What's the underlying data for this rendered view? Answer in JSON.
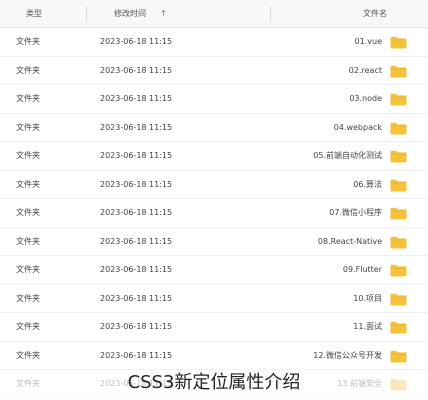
{
  "header": {
    "type_label": "类型",
    "time_label": "修改时间",
    "sort_arrow": "↑",
    "name_label": "文件名"
  },
  "rows": [
    {
      "type": "文件夹",
      "time": "2023-06-18 11:15",
      "name": "01.vue"
    },
    {
      "type": "文件夹",
      "time": "2023-06-18 11:15",
      "name": "02.react"
    },
    {
      "type": "文件夹",
      "time": "2023-06-18 11:15",
      "name": "03.node"
    },
    {
      "type": "文件夹",
      "time": "2023-06-18 11:15",
      "name": "04.webpack"
    },
    {
      "type": "文件夹",
      "time": "2023-06-18 11:15",
      "name": "05.前端自动化测试"
    },
    {
      "type": "文件夹",
      "time": "2023-06-18 11:15",
      "name": "06.算法"
    },
    {
      "type": "文件夹",
      "time": "2023-06-18 11:15",
      "name": "07.微信小程序"
    },
    {
      "type": "文件夹",
      "time": "2023-06-18 11:15",
      "name": "08.React-Native"
    },
    {
      "type": "文件夹",
      "time": "2023-06-18 11:15",
      "name": "09.Flutter"
    },
    {
      "type": "文件夹",
      "time": "2023-06-18 11:15",
      "name": "10.项目"
    },
    {
      "type": "文件夹",
      "time": "2023-06-18 11:15",
      "name": "11.面试"
    },
    {
      "type": "文件夹",
      "time": "2023-06-18 11:15",
      "name": "12.微信公众号开发"
    },
    {
      "type": "文件夹",
      "time": "2023-06-18 11:15",
      "name": "13.前端安全"
    }
  ],
  "folder_icon": "folder-icon",
  "colors": {
    "folder": "#f5c33b",
    "folder_tab": "#e9b52c",
    "accent": "#3a7bd5"
  },
  "caption": "CSS3新定位属性介绍"
}
